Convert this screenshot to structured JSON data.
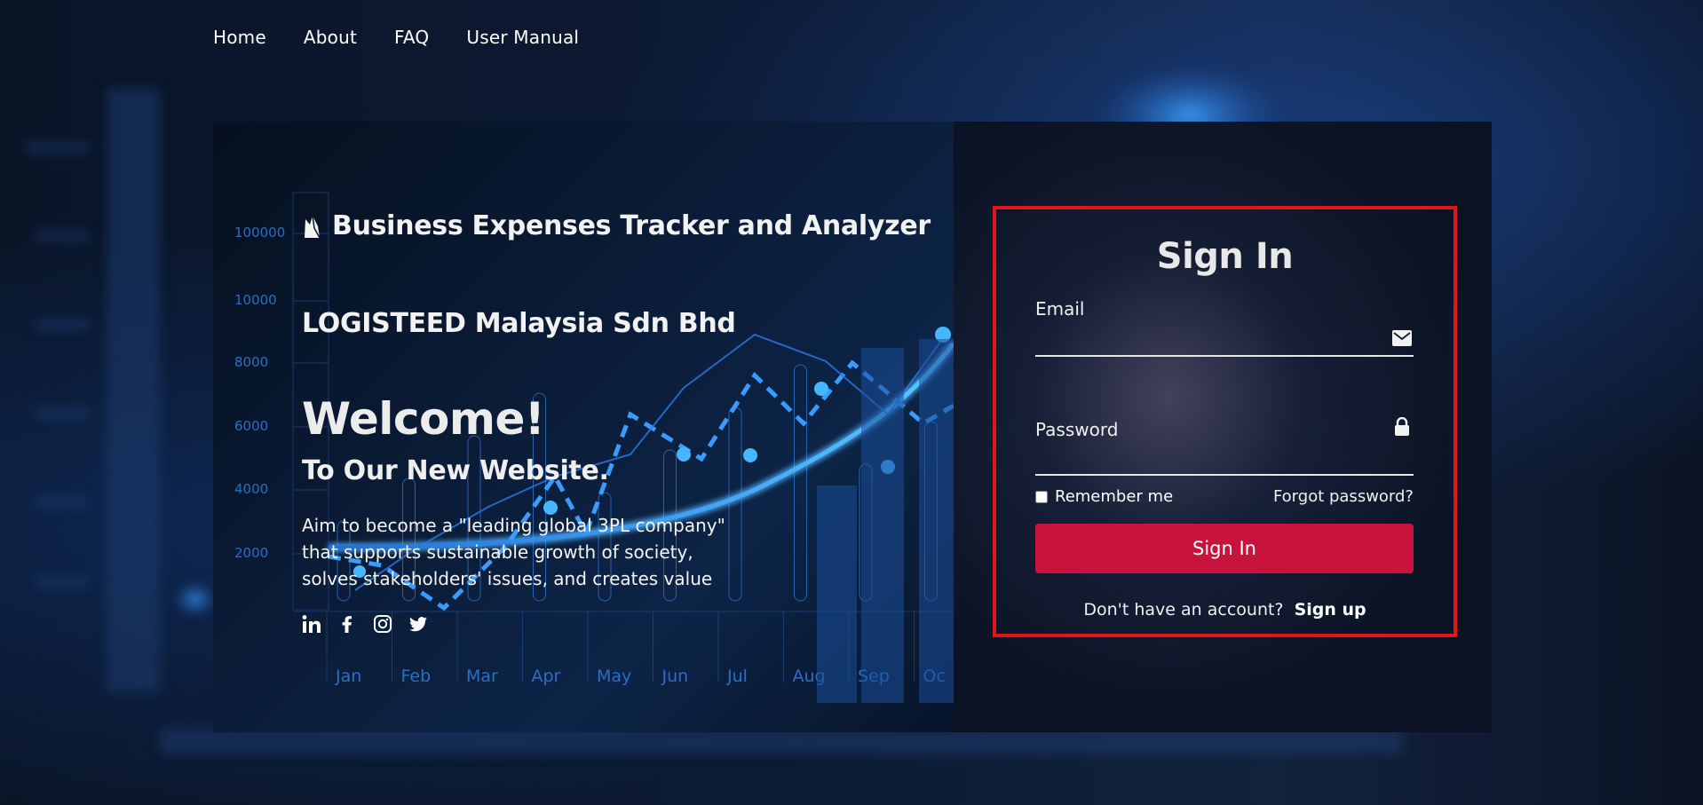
{
  "nav": {
    "items": [
      {
        "label": "Home"
      },
      {
        "label": "About"
      },
      {
        "label": "FAQ"
      },
      {
        "label": "User Manual"
      }
    ]
  },
  "brand": {
    "title": "Business Expenses Tracker and Analyzer",
    "icon": "logo-icon"
  },
  "hero": {
    "company": "LOGISTEED Malaysia Sdn Bhd",
    "welcome": "Welcome!",
    "subtitle": "To Our New Website.",
    "mission_line1": "Aim to become a \"leading global 3PL company\"",
    "mission_line2": "that supports sustainable growth of society,",
    "mission_line3": "solves stakeholders' issues, and creates value"
  },
  "background_chart": {
    "y_ticks": [
      "100000",
      "10000",
      "8000",
      "6000",
      "4000",
      "2000"
    ],
    "x_ticks": [
      "Jan",
      "Feb",
      "Mar",
      "Apr",
      "May",
      "Jun",
      "Jul",
      "Aug",
      "Sep",
      "Oc"
    ]
  },
  "social": [
    {
      "icon": "linkedin-icon"
    },
    {
      "icon": "facebook-icon"
    },
    {
      "icon": "instagram-icon"
    },
    {
      "icon": "twitter-icon"
    }
  ],
  "signin": {
    "title": "Sign In",
    "email_label": "Email",
    "email_value": "",
    "password_label": "Password",
    "password_value": "",
    "remember_label": "Remember me",
    "remember_checked": false,
    "forgot_label": "Forgot password?",
    "button_label": "Sign In",
    "no_account_text": "Don't have an account?",
    "signup_label": "Sign up"
  },
  "colors": {
    "accent": "#c8143c",
    "highlight_border": "#e0161b",
    "chart_blue": "#2e8bff"
  }
}
